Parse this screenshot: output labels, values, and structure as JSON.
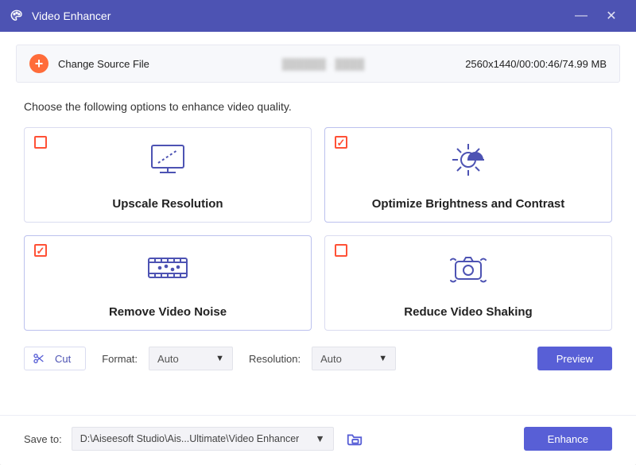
{
  "app": {
    "title": "Video Enhancer"
  },
  "source": {
    "button_label": "Change Source File",
    "filename": "（blurred）",
    "meta": "2560x1440/00:00:46/74.99 MB"
  },
  "prompt": "Choose the following options to enhance video quality.",
  "options": {
    "upscale": {
      "label": "Upscale Resolution",
      "checked": false
    },
    "brightness": {
      "label": "Optimize Brightness and Contrast",
      "checked": true
    },
    "denoise": {
      "label": "Remove Video Noise",
      "checked": true
    },
    "shaking": {
      "label": "Reduce Video Shaking",
      "checked": false
    }
  },
  "controls": {
    "cut_label": "Cut",
    "format_label": "Format:",
    "format_value": "Auto",
    "resolution_label": "Resolution:",
    "resolution_value": "Auto",
    "preview_label": "Preview"
  },
  "footer": {
    "save_label": "Save to:",
    "path": "D:\\Aiseesoft Studio\\Ais...Ultimate\\Video Enhancer",
    "enhance_label": "Enhance"
  },
  "colors": {
    "accent": "#585fd6",
    "titlebar": "#4d53b3",
    "check": "#ff5136"
  }
}
